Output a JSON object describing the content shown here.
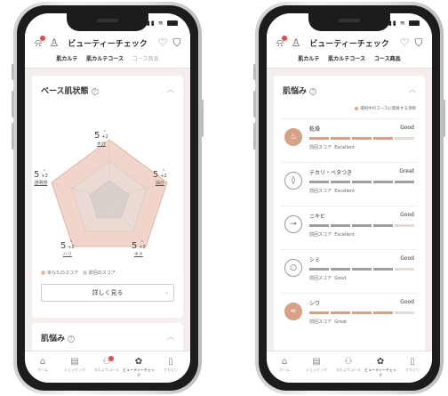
{
  "header": {
    "title": "ビューティーチェック"
  },
  "tabs_left": [
    "肌カルテ",
    "肌カルテコース",
    "コース商品"
  ],
  "tabs_right": [
    "肌カルテ",
    "肌カルテコース",
    "コース商品"
  ],
  "base_card": {
    "title": "ベース肌状態",
    "metrics": [
      {
        "name": "水分",
        "score": "5",
        "delta": "+2"
      },
      {
        "name": "油分",
        "score": "5",
        "delta": "+2"
      },
      {
        "name": "キメ",
        "score": "5",
        "delta": "+2"
      },
      {
        "name": "ハリ",
        "score": "5",
        "delta": "+2"
      },
      {
        "name": "透明感",
        "score": "5",
        "delta": "+3"
      }
    ],
    "legend_yours": "あなたのスコア",
    "legend_prev": "前回のスコア",
    "detail_button": "詳しく見る"
  },
  "concern_card_peek": {
    "title": "肌悩み",
    "peek_text": "選択中のコースに関係する項目"
  },
  "concerns_card": {
    "title": "肌悩み",
    "note": "選択中のコースに関係する項目",
    "prev_label": "前回スコア",
    "items": [
      {
        "name": "乾燥",
        "value": "Good",
        "prev": "Excellent",
        "icon": "dryness-icon",
        "highlight": true,
        "level": 4,
        "color": "fill"
      },
      {
        "name": "テカリ・ベタつき",
        "value": "Great",
        "prev": "Excellent",
        "icon": "oil-drop-icon",
        "highlight": false,
        "level": 5,
        "color": "gray"
      },
      {
        "name": "ニキビ",
        "value": "Good",
        "prev": "Excellent",
        "icon": "acne-icon",
        "highlight": false,
        "level": 4,
        "color": "gray"
      },
      {
        "name": "シミ",
        "value": "Good",
        "prev": "Good",
        "icon": "spot-icon",
        "highlight": false,
        "level": 4,
        "color": "gray"
      },
      {
        "name": "シワ",
        "value": "Good",
        "prev": "Great",
        "icon": "wrinkle-icon",
        "highlight": true,
        "level": 4,
        "color": "fill"
      }
    ]
  },
  "nav": [
    {
      "label": "ホーム",
      "icon": "home-icon"
    },
    {
      "label": "ショッピング",
      "icon": "shopping-icon"
    },
    {
      "label": "おたよりコース",
      "icon": "course-icon"
    },
    {
      "label": "ビューティーチェック",
      "icon": "beauty-check-icon"
    },
    {
      "label": "マガジン",
      "icon": "magazine-icon"
    }
  ],
  "colors": {
    "accent": "#d9a088",
    "alert": "#e34a4a",
    "background": "#f4efec"
  }
}
